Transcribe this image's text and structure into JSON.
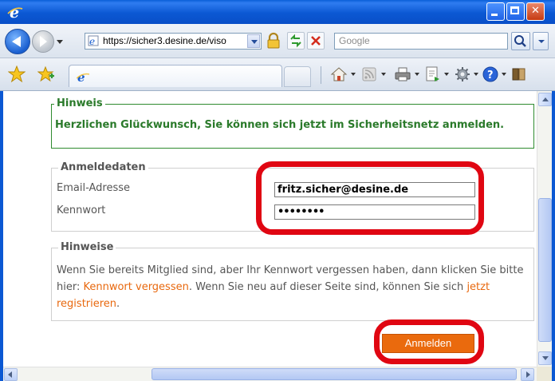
{
  "browser": {
    "address_url": "https://sicher3.desine.de/viso",
    "search_placeholder": "Google"
  },
  "hinweis": {
    "legend": "Hinweis",
    "message": "Herzlichen Glückwunsch, Sie können sich jetzt im Sicherheitsnetz anmelden."
  },
  "login": {
    "legend": "Anmeldedaten",
    "email_label": "Email-Adresse",
    "email_value": "fritz.sicher@desine.de",
    "password_label": "Kennwort",
    "password_value": "••••••••"
  },
  "hints": {
    "legend": "Hinweise",
    "text_1": "Wenn Sie bereits Mitglied sind, aber Ihr Kennwort vergessen haben, dann klicken Sie bitte hier: ",
    "forgot_link": "Kennwort vergessen",
    "text_2": ". Wenn Sie neu auf dieser Seite sind, können Sie sich ",
    "register_link": "jetzt registrieren",
    "text_3": "."
  },
  "submit": {
    "label": "Anmelden"
  },
  "colors": {
    "accent_orange": "#ea6a0d",
    "success_green": "#2a7a2a",
    "highlight_red": "#e00612",
    "xp_blue": "#0b58d3"
  }
}
